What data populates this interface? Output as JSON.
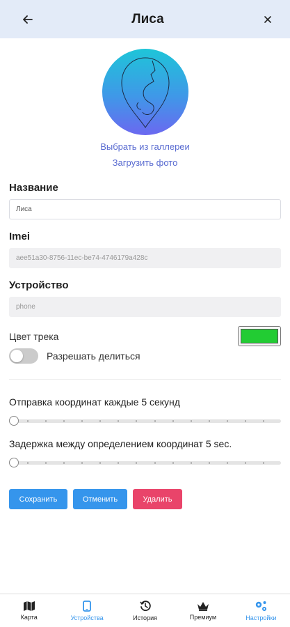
{
  "header": {
    "title": "Лиса",
    "back_icon": "arrow-left-icon",
    "close_icon": "close-icon"
  },
  "photo": {
    "choose_gallery": "Выбрать из галлереи",
    "upload": "Загрузить фото"
  },
  "fields": {
    "name_label": "Название",
    "name_value": "Лиса",
    "imei_label": "Imei",
    "imei_value": "aee51a30-8756-11ec-be74-4746179a428c",
    "device_label": "Устройство",
    "device_value": "phone"
  },
  "track": {
    "color_label": "Цвет трека",
    "color": "#22cc33"
  },
  "share": {
    "label": "Разрешать делиться",
    "enabled": false
  },
  "sliders": {
    "send_label": "Отправка координат каждые 5 секунд",
    "send_position": 0,
    "delay_label": "Задержка между определением координат 5 sec.",
    "delay_position": 0
  },
  "actions": {
    "save": "Сохранить",
    "cancel": "Отменить",
    "delete": "Удалить"
  },
  "tabs": [
    {
      "label": "Карта",
      "icon": "map-icon",
      "active": false
    },
    {
      "label": "Устройства",
      "icon": "phone-icon",
      "active": true
    },
    {
      "label": "История",
      "icon": "history-icon",
      "active": false
    },
    {
      "label": "Премиум",
      "icon": "crown-icon",
      "active": false
    },
    {
      "label": "Настройки",
      "icon": "gears-icon",
      "active": true
    }
  ],
  "colors": {
    "header_bg": "#e3ebf8",
    "accent": "#3595ec",
    "danger": "#e9446a",
    "link": "#5a6cd1"
  }
}
